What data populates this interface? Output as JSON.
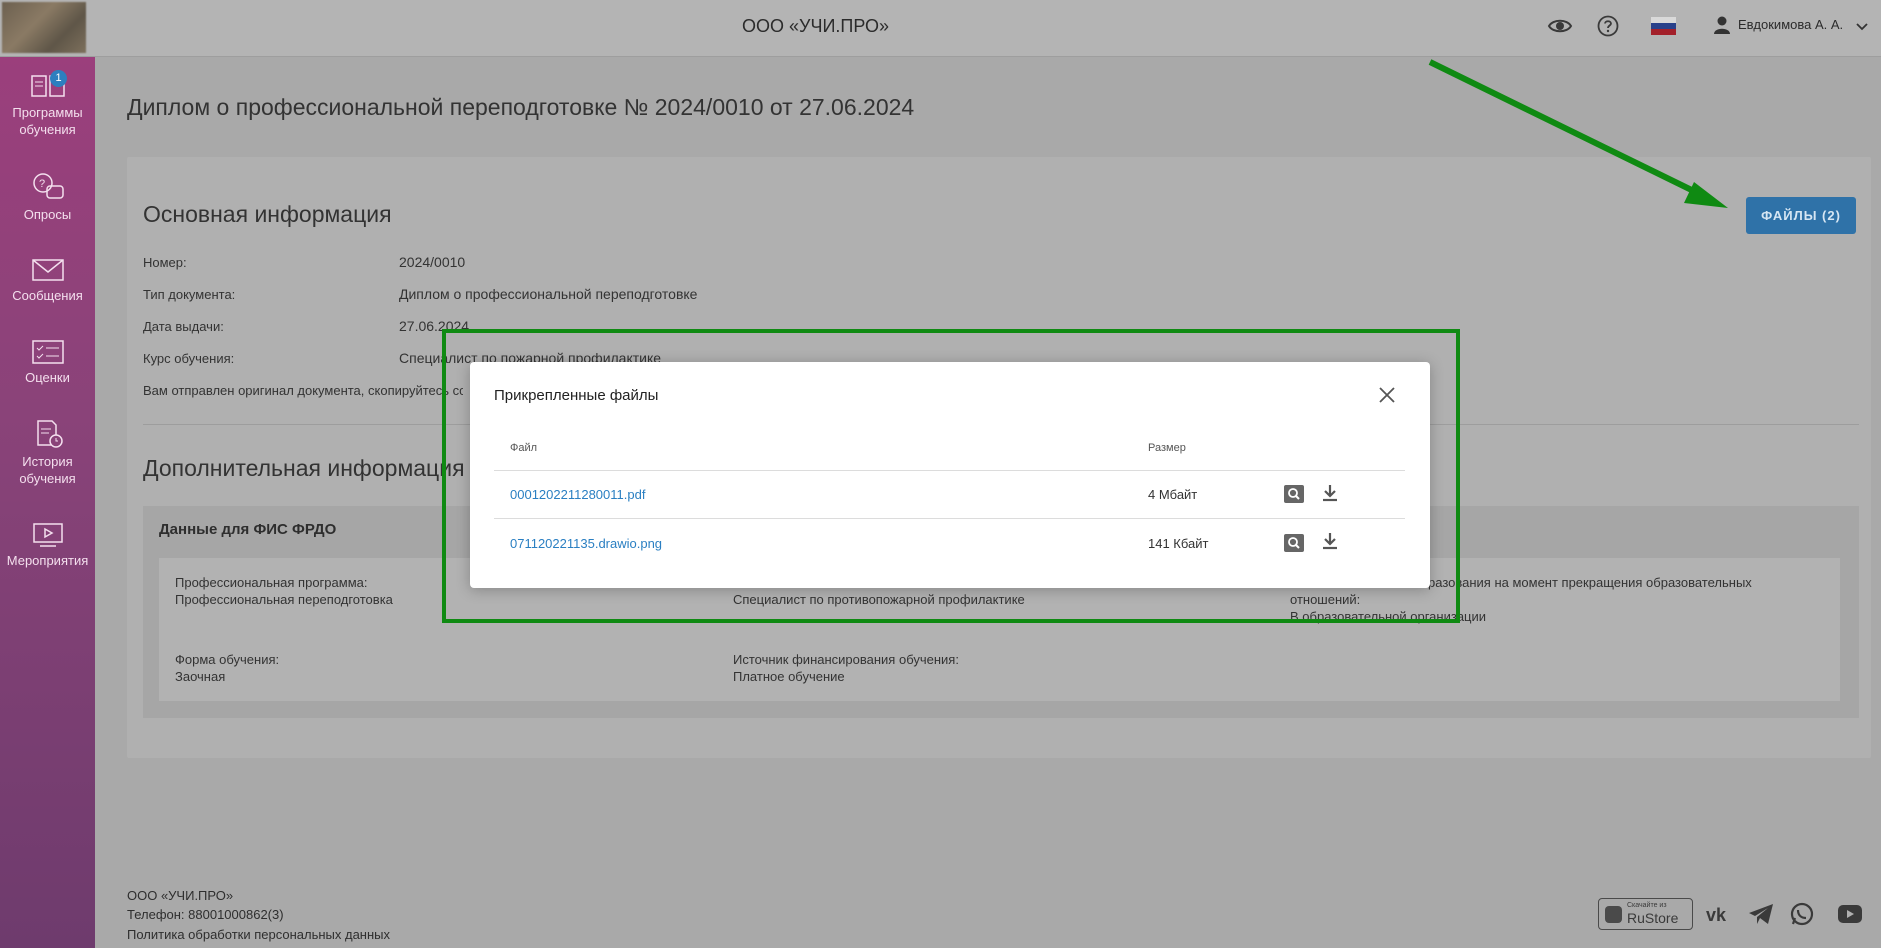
{
  "header": {
    "org_title": "ООО «УЧИ.ПРО»",
    "user_name": "Евдокимова А. А."
  },
  "sidebar": {
    "items": [
      {
        "label": "Программы обучения",
        "icon": "book-icon",
        "badge": "1"
      },
      {
        "label": "Опросы",
        "icon": "survey-icon"
      },
      {
        "label": "Сообщения",
        "icon": "envelope-icon"
      },
      {
        "label": "Оценки",
        "icon": "grades-icon"
      },
      {
        "label": "История обучения",
        "icon": "history-icon"
      },
      {
        "label": "Мероприятия",
        "icon": "event-icon"
      }
    ]
  },
  "main": {
    "page_title": "Диплом о профессиональной переподготовке № 2024/0010 от 27.06.2024",
    "files_button": "ФАЙЛЫ (2)",
    "basic_title": "Основная информация",
    "fields": {
      "number_label": "Номер:",
      "number_value": "2024/0010",
      "doctype_label": "Тип документа:",
      "doctype_value": "Диплом о профессиональной переподготовке",
      "issue_label": "Дата выдачи:",
      "issue_value": "27.06.2024",
      "course_label": "Курс обучения:",
      "course_value": "Специалист по пожарной профилактике"
    },
    "note": "Вам отправлен оригинал документа, скопируйтесь ссы",
    "extra_title": "Дополнительная информация",
    "fis_title": "Данные для ФИС ФРДО",
    "fis": {
      "program_label": "Профессиональная программа:",
      "program_value": "Профессиональная переподготовка",
      "qual_value": "Специалист по противопожарной профилактике",
      "edu_label_1": "разования на момент прекращения образовательных",
      "edu_label_2": "отношений:",
      "edu_value": "В образовательной организации",
      "form_label": "Форма обучения:",
      "form_value": "Заочная",
      "finance_label": "Источник финансирования обучения:",
      "finance_value": "Платное обучение"
    }
  },
  "modal": {
    "title": "Прикрепленные файлы",
    "col_file": "Файл",
    "col_size": "Размер",
    "files": [
      {
        "name": "0001202211280011.pdf",
        "size": "4 Мбайт"
      },
      {
        "name": "071120221135.drawio.png",
        "size": "141 Кбайт"
      }
    ]
  },
  "footer": {
    "org": "ООО «УЧИ.ПРО»",
    "phone": "Телефон: 88001000862(3)",
    "policy": "Политика обработки персональных данных",
    "rustore_small": "Скачайте из",
    "rustore_big": "RuStore"
  },
  "colors": {
    "accent": "#2f72a8",
    "annotation_green": "#0f8a12",
    "link": "#2a7fc2"
  }
}
